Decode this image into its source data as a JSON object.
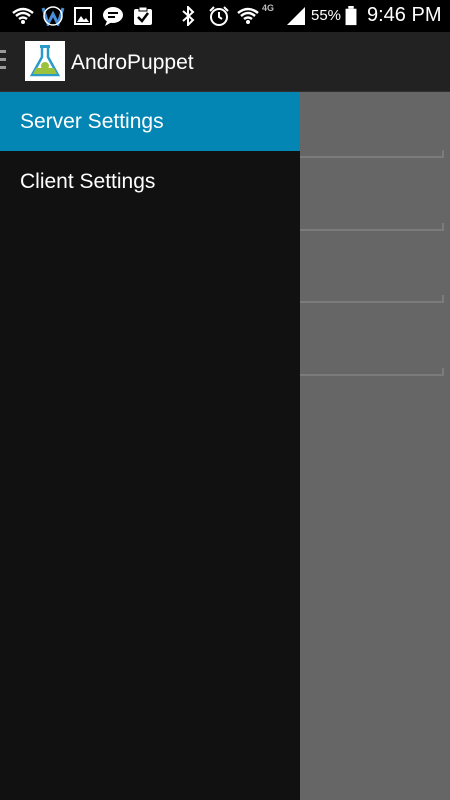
{
  "status_bar": {
    "icons": [
      "wifi-call-icon",
      "voicemail-icon",
      "image-icon",
      "message-icon",
      "clipboard-check-icon",
      "bluetooth-icon",
      "alarm-icon",
      "wifi-icon",
      "4g-lte-icon",
      "signal-icon",
      "battery-icon"
    ],
    "network_label": "4G",
    "battery_percent": "55%",
    "time": "9:46 PM"
  },
  "action_bar": {
    "title": "AndroPuppet",
    "logo_icon": "flask-android-logo-icon"
  },
  "drawer": {
    "items": [
      {
        "label": "Server Settings",
        "selected": true
      },
      {
        "label": "Client Settings",
        "selected": false
      }
    ]
  },
  "colors": {
    "accent": "#0386b4",
    "drawer_bg": "#111111",
    "action_bar_bg": "#222222",
    "content_dim": "#666666"
  }
}
